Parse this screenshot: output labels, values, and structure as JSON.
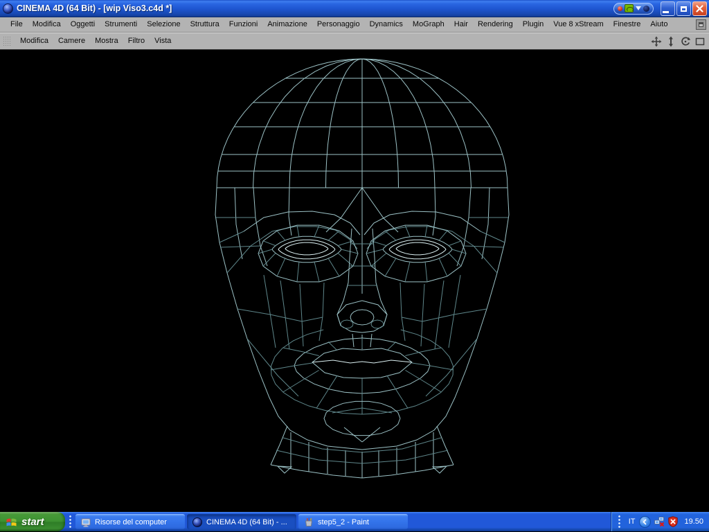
{
  "window": {
    "title": "CINEMA 4D (64 Bit) - [wip Viso3.c4d *]"
  },
  "menubar": {
    "items": [
      "File",
      "Modifica",
      "Oggetti",
      "Strumenti",
      "Selezione",
      "Struttura",
      "Funzioni",
      "Animazione",
      "Personaggio",
      "Dynamics",
      "MoGraph",
      "Hair",
      "Rendering",
      "Plugin",
      "Vue 8 xStream",
      "Finestre",
      "Aiuto"
    ]
  },
  "viewport_toolbar": {
    "items": [
      "Modifica",
      "Camere",
      "Mostra",
      "Filtro",
      "Vista"
    ],
    "nav_icons": [
      "pan-icon",
      "zoom-icon",
      "rotate-icon",
      "maximize-view-icon"
    ]
  },
  "viewport": {
    "content": "wireframe head model, front view"
  },
  "taskbar": {
    "start_label": "start",
    "buttons": [
      {
        "label": "Risorse del computer",
        "icon": "computer",
        "active": false
      },
      {
        "label": "CINEMA 4D (64 Bit) - ...",
        "icon": "cinema4d",
        "active": true
      },
      {
        "label": "step5_2 - Paint",
        "icon": "paint",
        "active": false
      }
    ],
    "tray": {
      "language": "IT",
      "time": "19.50",
      "icons": [
        "hide-icons-arrow",
        "network-disconnected",
        "security-alert-shield"
      ]
    }
  },
  "colors": {
    "titlebar_blue": "#2a66e2",
    "taskbar_blue": "#2158d8",
    "start_green": "#3d9232",
    "menubar_gray": "#b3b3b3",
    "viewport_bg": "#000000",
    "wireframe": "#9cc2c6",
    "wireframe_bright": "#def3f5",
    "nvidia_green": "#76b900"
  }
}
